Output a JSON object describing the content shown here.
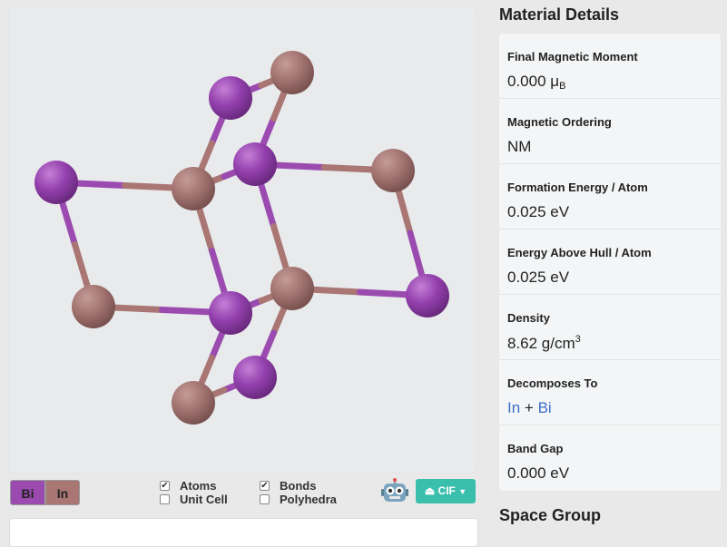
{
  "colors": {
    "bi": "#9b4bb0",
    "in": "#a97674",
    "accent": "#3bbfad",
    "link": "#3a70c8"
  },
  "legend": {
    "bi": "Bi",
    "in": "In"
  },
  "options": {
    "atoms": {
      "label": "Atoms",
      "checked": true
    },
    "unit_cell": {
      "label": "Unit Cell",
      "checked": false
    },
    "bonds": {
      "label": "Bonds",
      "checked": true
    },
    "polyhedra": {
      "label": "Polyhedra",
      "checked": false
    }
  },
  "download": {
    "label": "CIF",
    "icon": "download-icon"
  },
  "details_title": "Material Details",
  "space_group_title": "Space Group",
  "properties": {
    "magnetic_moment": {
      "label": "Final Magnetic Moment",
      "value": "0.000 μ",
      "sub": "B"
    },
    "magnetic_ordering": {
      "label": "Magnetic Ordering",
      "value": "NM"
    },
    "formation_energy": {
      "label": "Formation Energy / Atom",
      "value": "0.025 eV"
    },
    "energy_above_hull": {
      "label": "Energy Above Hull / Atom",
      "value": "0.025 eV"
    },
    "density": {
      "label": "Density",
      "value": "8.62 g/cm",
      "sup": "3"
    },
    "decomposes_to": {
      "label": "Decomposes To",
      "a": "In",
      "plus": " + ",
      "b": "Bi"
    },
    "band_gap": {
      "label": "Band Gap",
      "value": "0.000 eV"
    }
  }
}
